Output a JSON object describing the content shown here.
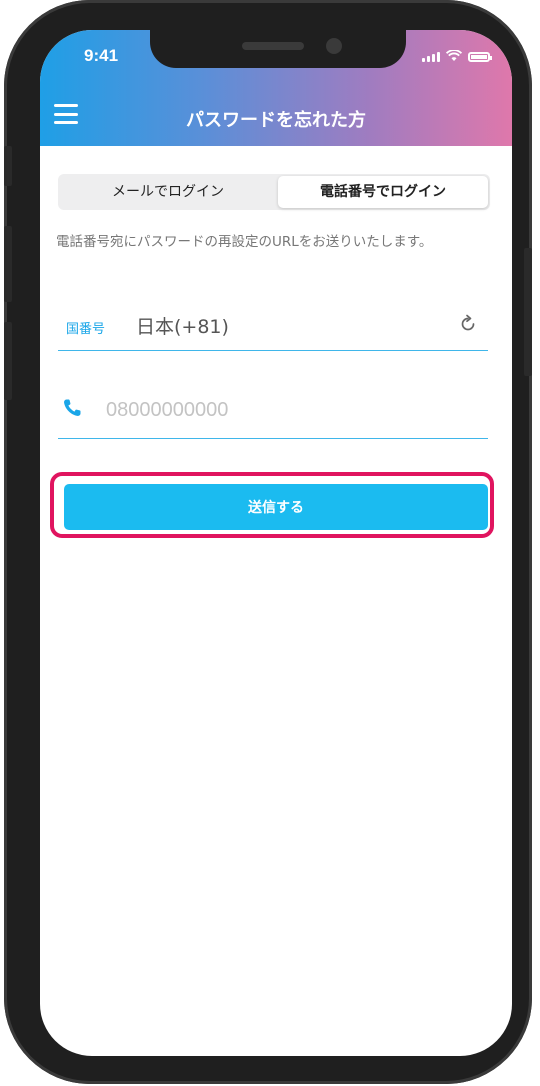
{
  "status_bar": {
    "time": "9:41",
    "icons": [
      "signal-icon",
      "wifi-icon",
      "battery-icon"
    ]
  },
  "header": {
    "title": "パスワードを忘れた方",
    "menu_icon": "hamburger-menu-icon",
    "gradient": [
      "#1f9fe6",
      "#df78ab"
    ]
  },
  "tabs": [
    {
      "label": "メールでログイン",
      "selected": false
    },
    {
      "label": "電話番号でログイン",
      "selected": true
    }
  ],
  "instruction": "電話番号宛にパスワードの再設定のURLをお送りいたします。",
  "country": {
    "label": "国番号",
    "value": "日本(+81)",
    "icon": "refresh-icon"
  },
  "phone": {
    "value": "",
    "placeholder": "08000000000",
    "icon": "phone-icon"
  },
  "submit": {
    "label": "送信する",
    "color": "#1bbbf0",
    "highlight_color": "#e0145f"
  }
}
